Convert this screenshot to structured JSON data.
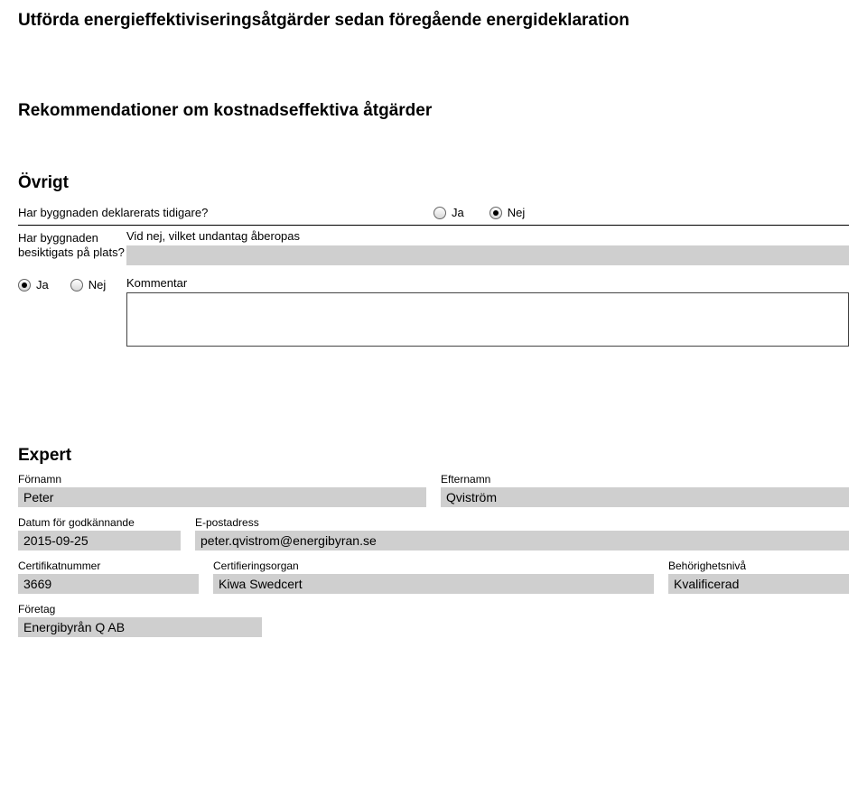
{
  "sections": {
    "utforda_title": "Utförda energieffektiviseringsåtgärder sedan föregående energideklaration",
    "rekom_title": "Rekommendationer om kostnadseffektiva åtgärder",
    "ovrigt_title": "Övrigt",
    "expert_title": "Expert"
  },
  "ovrigt": {
    "tidigare_question": "Har byggnaden deklarerats tidigare?",
    "ja_label": "Ja",
    "nej_label": "Nej",
    "tidigare_selected": "nej",
    "besiktigats_label": "Har byggnaden besiktigats på plats?",
    "undantag_label": "Vid nej, vilket undantag åberopas",
    "undantag_value": "",
    "besiktigats_selected": "ja",
    "kommentar_label": "Kommentar",
    "kommentar_value": ""
  },
  "expert": {
    "fornamn_label": "Förnamn",
    "fornamn": "Peter",
    "efternamn_label": "Efternamn",
    "efternamn": "Qviström",
    "datum_label": "Datum för godkännande",
    "datum": "2015-09-25",
    "epost_label": "E-postadress",
    "epost": "peter.qvistrom@energibyran.se",
    "certnr_label": "Certifikatnummer",
    "certnr": "3669",
    "organ_label": "Certifieringsorgan",
    "organ": "Kiwa Swedcert",
    "niva_label": "Behörighetsnivå",
    "niva": "Kvalificerad",
    "foretag_label": "Företag",
    "foretag": "Energibyrån Q AB"
  }
}
